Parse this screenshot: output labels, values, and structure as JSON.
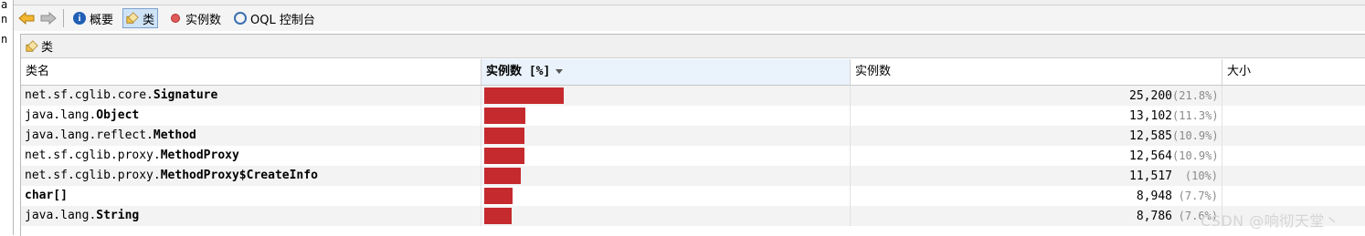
{
  "left_strip": [
    "a",
    "n",
    "n"
  ],
  "toolbar": {
    "summary_label": "概要",
    "classes_label": "类",
    "instances_label": "实例数",
    "oql_label": "OQL 控制台"
  },
  "panel": {
    "title": "类"
  },
  "table": {
    "columns": [
      "类名",
      "实例数 [%]",
      "实例数",
      "大小"
    ],
    "rows": [
      {
        "pkg": "net.sf.cglib.core.",
        "cls": "Signature",
        "count": "25,200",
        "pct": "(21.8%)",
        "fraction": 0.218
      },
      {
        "pkg": "java.lang.",
        "cls": "Object",
        "count": "13,102",
        "pct": "(11.3%)",
        "fraction": 0.113
      },
      {
        "pkg": "java.lang.reflect.",
        "cls": "Method",
        "count": "12,585",
        "pct": "(10.9%)",
        "fraction": 0.109
      },
      {
        "pkg": "net.sf.cglib.proxy.",
        "cls": "MethodProxy",
        "count": "12,564",
        "pct": "(10.9%)",
        "fraction": 0.109
      },
      {
        "pkg": "net.sf.cglib.proxy.",
        "cls": "MethodProxy$CreateInfo",
        "count": "11,517",
        "pct": "(10%)",
        "fraction": 0.1
      },
      {
        "pkg": "",
        "cls": "char[]",
        "count": "8,948",
        "pct": "(7.7%)",
        "fraction": 0.077
      },
      {
        "pkg": "java.lang.",
        "cls": "String",
        "count": "8,786",
        "pct": "(7.6%)",
        "fraction": 0.076
      }
    ]
  },
  "watermark": "CSDN @响彻天堂丶"
}
